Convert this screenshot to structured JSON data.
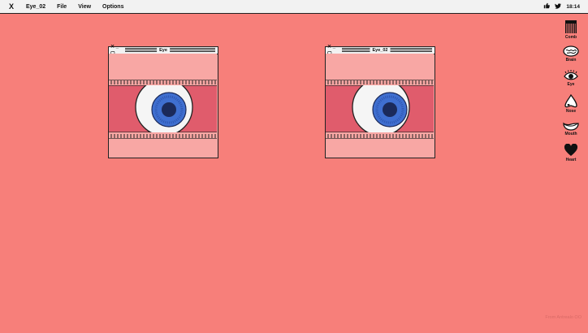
{
  "menubar": {
    "logo": "X",
    "app_name": "Eye_02",
    "menu": [
      "File",
      "View",
      "Options"
    ],
    "clock": "18:14"
  },
  "windows": [
    {
      "title": "Eye",
      "controls": "✕ _ ▢"
    },
    {
      "title": "Eye_02",
      "controls": "✕ _ ▢"
    }
  ],
  "dock": [
    {
      "label": "Comb",
      "icon": "comb-icon"
    },
    {
      "label": "Brain",
      "icon": "brain-icon"
    },
    {
      "label": "Eye",
      "icon": "eye-icon"
    },
    {
      "label": "Nose",
      "icon": "nose-icon"
    },
    {
      "label": "Mouth",
      "icon": "mouth-icon"
    },
    {
      "label": "Heart",
      "icon": "heart-icon"
    }
  ],
  "credit": "From Antrealo OO",
  "colors": {
    "background": "#f77f7a",
    "window_fill": "#f8a7a4",
    "eyelid_band": "#e05c6c",
    "iris": "#3f6fd0",
    "pupil": "#1b2a5a"
  }
}
